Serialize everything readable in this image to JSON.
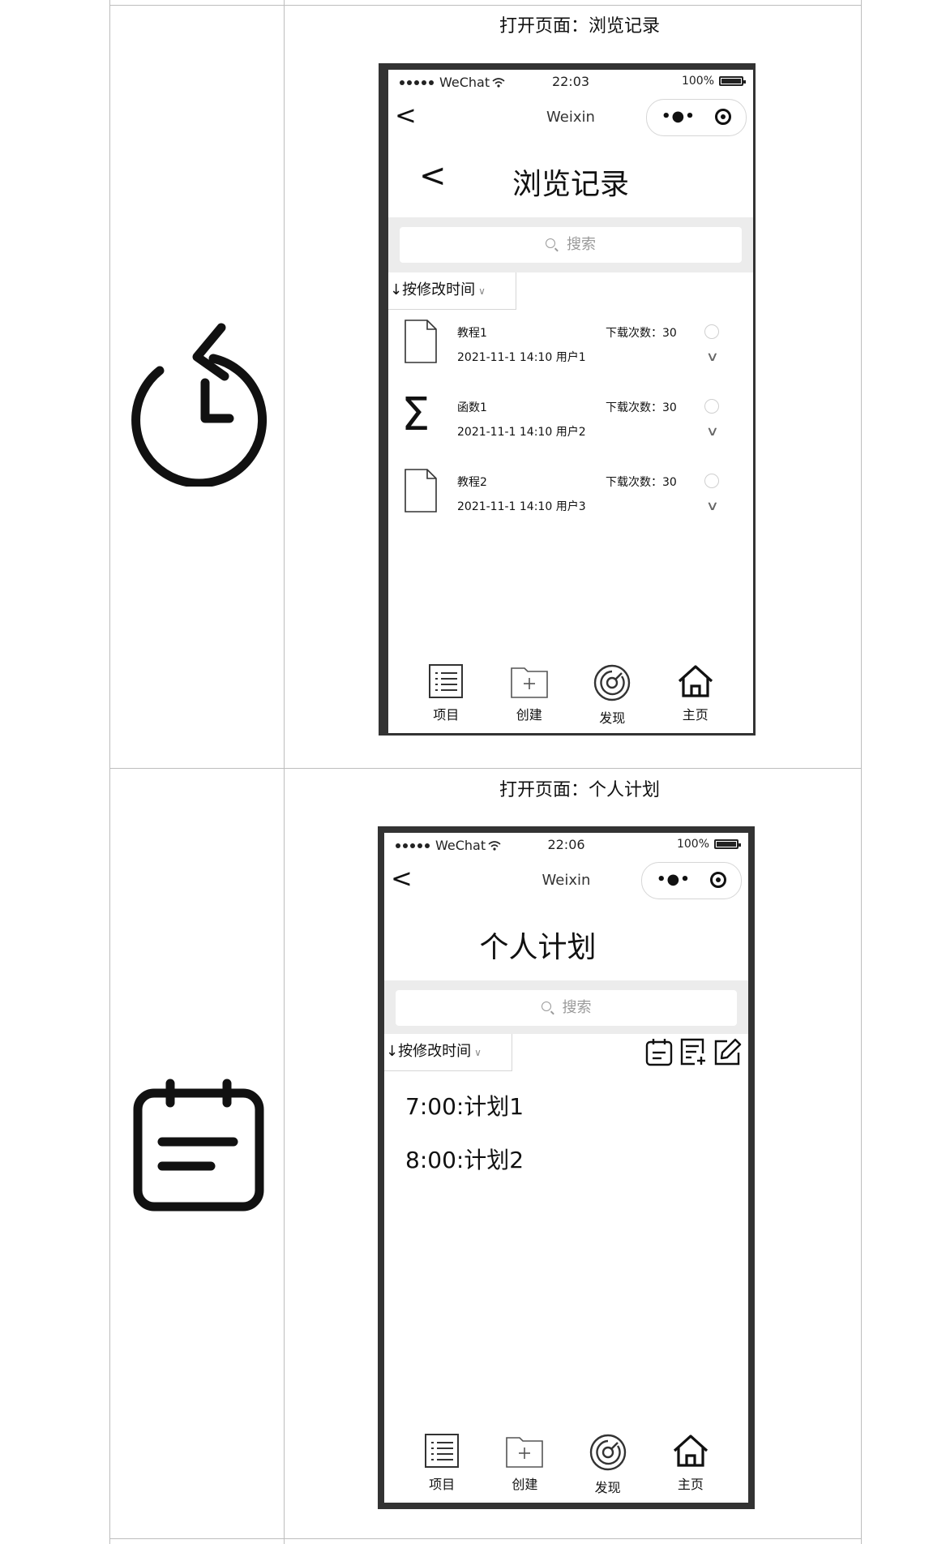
{
  "row1": {
    "caption": "打开页面：浏览记录",
    "icon": "history-icon",
    "phone": {
      "status": {
        "carrier": "WeChat",
        "time": "22:03",
        "battery": "100%"
      },
      "nav": {
        "back": "<",
        "title": "Weixin"
      },
      "header": {
        "back": "<",
        "title": "浏览记录"
      },
      "search": {
        "placeholder": "搜索"
      },
      "sort": {
        "label": "↓按修改时间"
      },
      "items": [
        {
          "icon": "file-icon",
          "name": "教程1",
          "meta": "2021-11-1 14:10 用户1",
          "downloads": "下载次数：30"
        },
        {
          "icon": "sigma-icon",
          "name": "函数1",
          "meta": "2021-11-1 14:10 用户2",
          "downloads": "下载次数：30"
        },
        {
          "icon": "file-icon",
          "name": "教程2",
          "meta": "2021-11-1 14:10 用户3",
          "downloads": "下载次数：30"
        }
      ],
      "tabs": [
        {
          "icon": "list-icon",
          "label": "项目"
        },
        {
          "icon": "folder-add-icon",
          "label": "创建"
        },
        {
          "icon": "compass-icon",
          "label": "发现"
        },
        {
          "icon": "home-icon",
          "label": "主页"
        }
      ]
    }
  },
  "row2": {
    "caption": "打开页面：个人计划",
    "icon": "calendar-icon",
    "phone": {
      "status": {
        "carrier": "WeChat",
        "time": "22:06",
        "battery": "100%"
      },
      "nav": {
        "back": "<",
        "title": "Weixin"
      },
      "header": {
        "title": "个人计划"
      },
      "search": {
        "placeholder": "搜索"
      },
      "sort": {
        "label": "↓按修改时间"
      },
      "toolbar_icons": [
        "calendar-icon",
        "note-add-icon",
        "edit-icon"
      ],
      "plans": [
        "7:00:计划1",
        "8:00:计划2"
      ],
      "tabs": [
        {
          "icon": "list-icon",
          "label": "项目"
        },
        {
          "icon": "folder-add-icon",
          "label": "创建"
        },
        {
          "icon": "compass-icon",
          "label": "发现"
        },
        {
          "icon": "home-icon",
          "label": "主页"
        }
      ]
    }
  }
}
